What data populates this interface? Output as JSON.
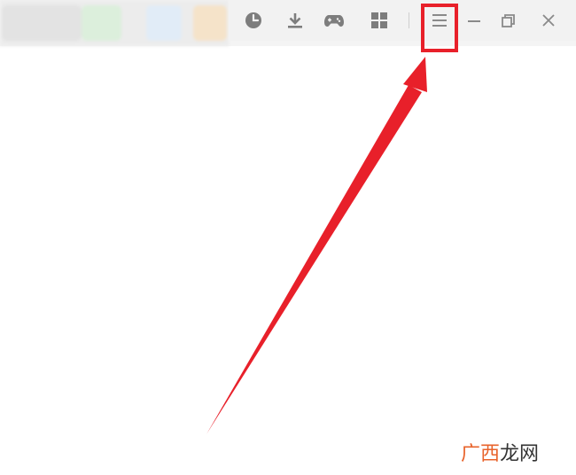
{
  "toolbar": {
    "icons": [
      "history-clock-icon",
      "download-icon",
      "gamepad-icon",
      "apps-grid-icon",
      "hamburger-menu-icon",
      "minimize-icon",
      "restore-icon",
      "close-icon"
    ]
  },
  "annotation": {
    "highlight_color": "#e8202a",
    "target": "hamburger-menu-icon"
  },
  "watermark": {
    "part1": "广西",
    "part2": "龙网",
    "part1_color": "#e8632b",
    "part2_color": "#333333"
  }
}
